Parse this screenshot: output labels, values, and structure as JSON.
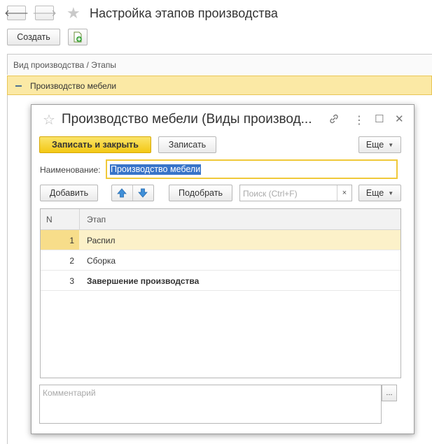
{
  "nav": {
    "back_icon": "arrow-left-icon",
    "back_glyph": "🡐",
    "forward_icon": "arrow-right-icon",
    "forward_glyph": "🡒",
    "favorite_glyph": "★",
    "title": "Настройка этапов производства"
  },
  "toolbar": {
    "create_label": "Создать"
  },
  "list": {
    "header": "Вид производства / Этапы",
    "selected_item": "Производство мебели"
  },
  "dialog": {
    "favorite_glyph": "☆",
    "title": "Производство мебели (Виды производ...",
    "link_glyph": "🔗",
    "menu_glyph": "⋮",
    "maximize_glyph": "☐",
    "close_glyph": "✕",
    "save_close_label": "Записать и закрыть",
    "save_label": "Записать",
    "more_label": "Еще",
    "name_label": "Наименование:",
    "name_value": "Производство мебели",
    "add_label": "Добавить",
    "pick_label": "Подобрать",
    "search_placeholder": "Поиск (Ctrl+F)",
    "search_clear_glyph": "×",
    "more2_label": "Еще",
    "table": {
      "col_n": "N",
      "col_stage": "Этап",
      "rows": [
        {
          "n": "1",
          "stage": "Распил"
        },
        {
          "n": "2",
          "stage": "Сборка"
        },
        {
          "n": "3",
          "stage": "Завершение производства"
        }
      ]
    },
    "comment_placeholder": "Комментарий",
    "ellipsis": "..."
  },
  "colors": {
    "accent_yellow": "#f3c814",
    "selection_row": "#fbe9a5",
    "text_selection": "#3874c9",
    "arrow_blue": "#3f8fd8"
  }
}
